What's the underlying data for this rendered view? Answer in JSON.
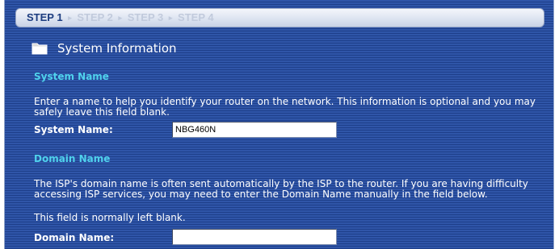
{
  "wizard": {
    "steps": [
      "STEP 1",
      "STEP 2",
      "STEP 3",
      "STEP 4"
    ],
    "active_step": 0,
    "separator": "▸"
  },
  "section": {
    "icon": "folder-icon",
    "title": "System Information"
  },
  "system_name": {
    "heading": "System Name",
    "description": "Enter a name to help you identify your router on the network. This information is optional and you may safely leave this field blank.",
    "label": "System Name:",
    "value": "NBG460N",
    "placeholder": ""
  },
  "domain_name": {
    "heading": "Domain Name",
    "description": "The ISP's domain name is often sent automatically by the ISP to the router. If you are having difficulty accessing ISP services, you may need to enter the Domain Name manually in the field below.",
    "note": "This field is normally left blank.",
    "label": "Domain Name:",
    "value": "",
    "placeholder": ""
  },
  "colors": {
    "panel_background": "#2a4d9c",
    "subheading": "#4fd2ec",
    "active_step": "#1c3c7f",
    "inactive_step": "#c1cadc"
  }
}
